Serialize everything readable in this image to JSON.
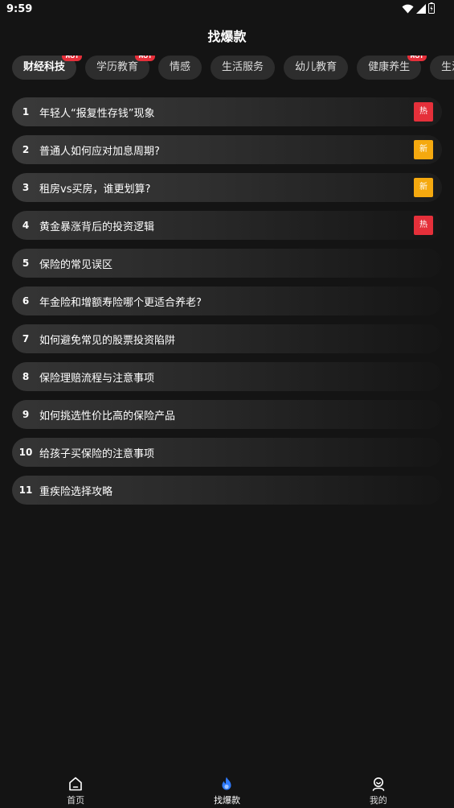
{
  "status": {
    "time": "9:59"
  },
  "title": "找爆款",
  "chips": [
    {
      "label": "财经科技",
      "hot": "HOT",
      "active": true
    },
    {
      "label": "学历教育",
      "hot": "HOT",
      "active": false
    },
    {
      "label": "情感",
      "hot": "",
      "active": false
    },
    {
      "label": "生活服务",
      "hot": "",
      "active": false
    },
    {
      "label": "幼儿教育",
      "hot": "",
      "active": false
    },
    {
      "label": "健康养生",
      "hot": "HOT",
      "active": false
    },
    {
      "label": "生活购物",
      "hot": "",
      "active": false
    }
  ],
  "topics": [
    {
      "rank": "1",
      "text": "年轻人“报复性存钱”现象",
      "tag": "热",
      "tag_type": "hot"
    },
    {
      "rank": "2",
      "text": "普通人如何应对加息周期?",
      "tag": "新",
      "tag_type": "new"
    },
    {
      "rank": "3",
      "text": "租房vs买房，谁更划算?",
      "tag": "新",
      "tag_type": "new"
    },
    {
      "rank": "4",
      "text": "黄金暴涨背后的投资逻辑",
      "tag": "热",
      "tag_type": "hot"
    },
    {
      "rank": "5",
      "text": "保险的常见误区",
      "tag": "",
      "tag_type": ""
    },
    {
      "rank": "6",
      "text": "年金险和增额寿险哪个更适合养老?",
      "tag": "",
      "tag_type": ""
    },
    {
      "rank": "7",
      "text": "如何避免常见的股票投资陷阱",
      "tag": "",
      "tag_type": ""
    },
    {
      "rank": "8",
      "text": "保险理赔流程与注意事项",
      "tag": "",
      "tag_type": ""
    },
    {
      "rank": "9",
      "text": "如何挑选性价比高的保险产品",
      "tag": "",
      "tag_type": ""
    },
    {
      "rank": "10",
      "text": "给孩子买保险的注意事项",
      "tag": "",
      "tag_type": ""
    },
    {
      "rank": "11",
      "text": "重疾险选择攻略",
      "tag": "",
      "tag_type": ""
    }
  ],
  "nav": {
    "home": "首页",
    "find": "找爆款",
    "mine": "我的",
    "accent": "#2f7bff"
  }
}
